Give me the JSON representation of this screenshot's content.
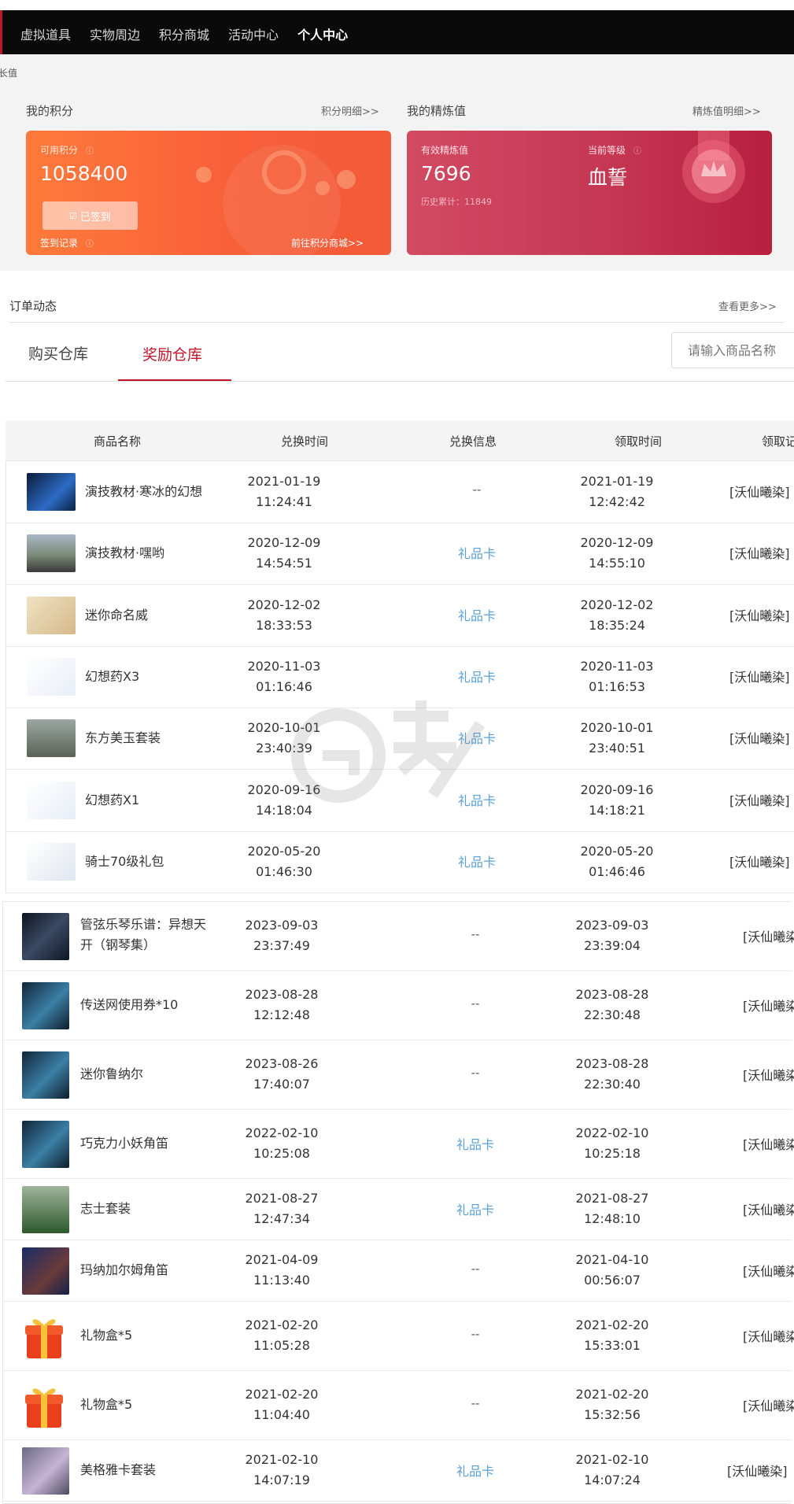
{
  "nav": {
    "items": [
      "虚拟道具",
      "实物周边",
      "积分商城",
      "活动中心",
      "个人中心"
    ],
    "active_index": 4
  },
  "breadcrumb": "成长值",
  "points": {
    "title": "我的积分",
    "detail_link": "积分明细>>",
    "available_label": "可用积分",
    "available_value": "1058400",
    "signed_button": "已签到",
    "sign_record": "签到记录",
    "mall_link": "前往积分商城>>"
  },
  "refine": {
    "title": "我的精炼值",
    "detail_link": "精炼值明细>>",
    "valid_label": "有效精炼值",
    "valid_value": "7696",
    "history_label": "历史累计：11849",
    "level_label": "当前等级",
    "level_value": "血誓"
  },
  "orders": {
    "title": "订单动态",
    "more_link": "查看更多>>"
  },
  "tabs": [
    "购买仓库",
    "奖励仓库"
  ],
  "active_tab": 1,
  "search": {
    "placeholder": "请输入商品名称"
  },
  "table": {
    "headers": [
      "商品名称",
      "兑换时间",
      "兑换信息",
      "领取时间",
      "领取"
    ],
    "group1": [
      {
        "name": "演技教材·寒冰的幻想",
        "ex_date": "2021-01-19",
        "ex_time": "11:24:41",
        "info": "--",
        "rc_date": "2021-01-19",
        "rc_time": "12:42:42",
        "receiver": "[沃仙曦染]"
      },
      {
        "name": "演技教材·嘿哟",
        "ex_date": "2020-12-09",
        "ex_time": "14:54:51",
        "info": "礼品卡",
        "rc_date": "2020-12-09",
        "rc_time": "14:55:10",
        "receiver": "[沃仙曦染]"
      },
      {
        "name": "迷你命名威",
        "ex_date": "2020-12-02",
        "ex_time": "18:33:53",
        "info": "礼品卡",
        "rc_date": "2020-12-02",
        "rc_time": "18:35:24",
        "receiver": "[沃仙曦染]"
      },
      {
        "name": "幻想药X3",
        "ex_date": "2020-11-03",
        "ex_time": "01:16:46",
        "info": "礼品卡",
        "rc_date": "2020-11-03",
        "rc_time": "01:16:53",
        "receiver": "[沃仙曦染]"
      },
      {
        "name": "东方美玉套装",
        "ex_date": "2020-10-01",
        "ex_time": "23:40:39",
        "info": "礼品卡",
        "rc_date": "2020-10-01",
        "rc_time": "23:40:51",
        "receiver": "[沃仙曦染]"
      },
      {
        "name": "幻想药X1",
        "ex_date": "2020-09-16",
        "ex_time": "14:18:04",
        "info": "礼品卡",
        "rc_date": "2020-09-16",
        "rc_time": "14:18:21",
        "receiver": "[沃仙曦染]"
      },
      {
        "name": "骑士70级礼包",
        "ex_date": "2020-05-20",
        "ex_time": "01:46:30",
        "info": "礼品卡",
        "rc_date": "2020-05-20",
        "rc_time": "01:46:46",
        "receiver": "[沃仙曦染]"
      }
    ],
    "group2": [
      {
        "name1": "管弦乐琴乐谱：异想天",
        "name2": "开（钢琴集）",
        "ex_date": "2023-09-03",
        "ex_time": "23:37:49",
        "info": "--",
        "rc_date": "2023-09-03",
        "rc_time": "23:39:04",
        "receiver": "[沃仙曦染"
      },
      {
        "name1": "传送网使用券*10",
        "name2": "",
        "ex_date": "2023-08-28",
        "ex_time": "12:12:48",
        "info": "--",
        "rc_date": "2023-08-28",
        "rc_time": "22:30:48",
        "receiver": "[沃仙曦染"
      },
      {
        "name1": "迷你鲁纳尔",
        "name2": "",
        "ex_date": "2023-08-26",
        "ex_time": "17:40:07",
        "info": "--",
        "rc_date": "2023-08-28",
        "rc_time": "22:30:40",
        "receiver": "[沃仙曦染"
      },
      {
        "name1": "巧克力小妖角笛",
        "name2": "",
        "ex_date": "2022-02-10",
        "ex_time": "10:25:08",
        "info": "礼品卡",
        "rc_date": "2022-02-10",
        "rc_time": "10:25:18",
        "receiver": "[沃仙曦染"
      },
      {
        "name1": "志士套装",
        "name2": "",
        "ex_date": "2021-08-27",
        "ex_time": "12:47:34",
        "info": "礼品卡",
        "rc_date": "2021-08-27",
        "rc_time": "12:48:10",
        "receiver": "[沃仙曦染"
      },
      {
        "name1": "玛纳加尔姆角笛",
        "name2": "",
        "ex_date": "2021-04-09",
        "ex_time": "11:13:40",
        "info": "--",
        "rc_date": "2021-04-10",
        "rc_time": "00:56:07",
        "receiver": "[沃仙曦染"
      },
      {
        "name1": "礼物盒*5",
        "name2": "",
        "ex_date": "2021-02-20",
        "ex_time": "11:05:28",
        "info": "--",
        "rc_date": "2021-02-20",
        "rc_time": "15:33:01",
        "receiver": "[沃仙曦染"
      },
      {
        "name1": "礼物盒*5",
        "name2": "",
        "ex_date": "2021-02-20",
        "ex_time": "11:04:40",
        "info": "--",
        "rc_date": "2021-02-20",
        "rc_time": "15:32:56",
        "receiver": "[沃仙曦染"
      },
      {
        "name1": "美格雅卡套装",
        "name2": "",
        "ex_date": "2021-02-10",
        "ex_time": "14:07:19",
        "info": "礼品卡",
        "rc_date": "2021-02-10",
        "rc_time": "14:07:24",
        "receiver": "[沃仙曦染]"
      }
    ]
  },
  "colors": {
    "accent": "#c0142a",
    "link_blue": "#5aa0d8",
    "orange": "#f8603a",
    "crimson": "#c53753"
  }
}
